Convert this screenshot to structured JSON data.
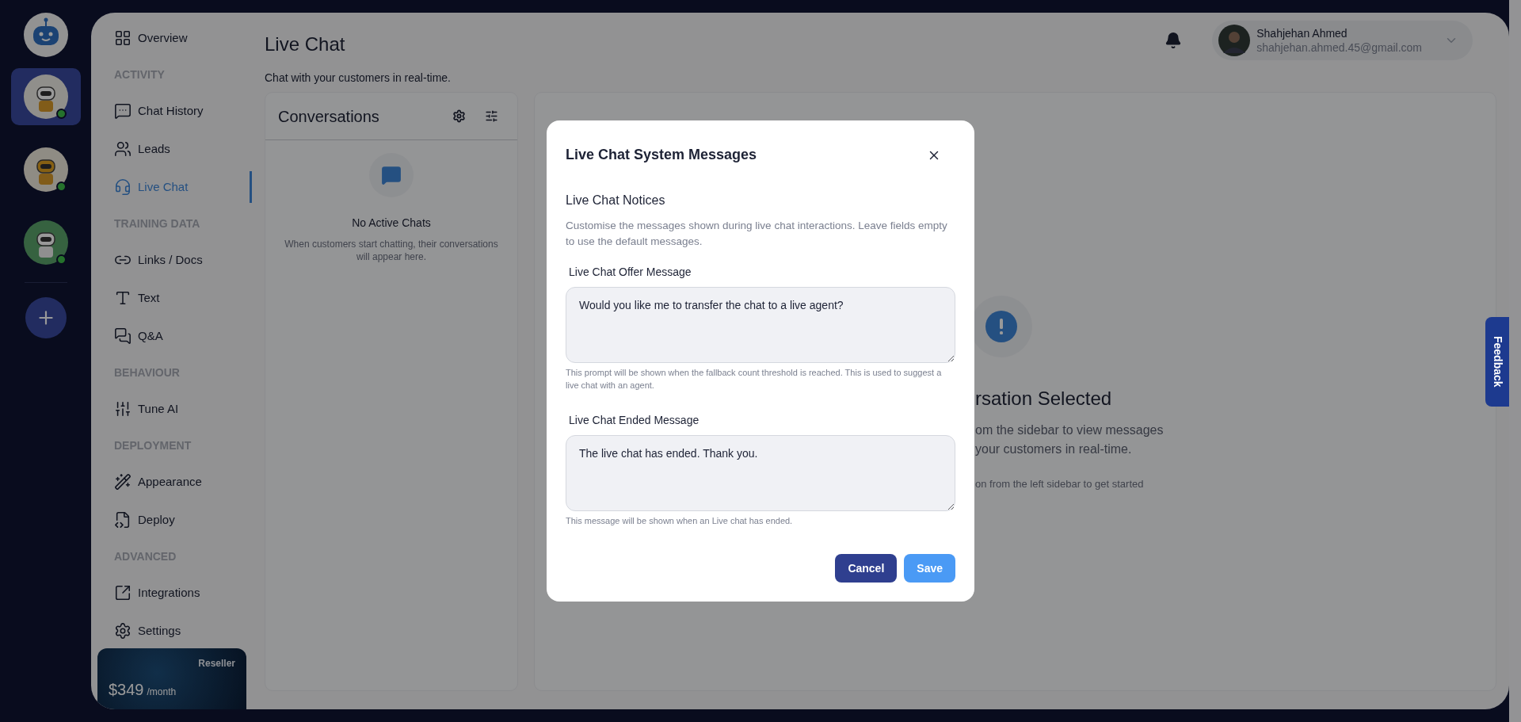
{
  "rail": {
    "bots": [
      {
        "selected": true,
        "online": true
      },
      {
        "selected": false,
        "online": true
      },
      {
        "selected": false,
        "online": true
      }
    ]
  },
  "sidebar": {
    "items": [
      {
        "kind": "item",
        "label": "Overview",
        "selected": false
      },
      {
        "kind": "header",
        "label": "ACTIVITY"
      },
      {
        "kind": "item",
        "label": "Chat History",
        "selected": false
      },
      {
        "kind": "item",
        "label": "Leads",
        "selected": false
      },
      {
        "kind": "item",
        "label": "Live Chat",
        "selected": true
      },
      {
        "kind": "header",
        "label": "TRAINING DATA"
      },
      {
        "kind": "item",
        "label": "Links / Docs",
        "selected": false
      },
      {
        "kind": "item",
        "label": "Text",
        "selected": false
      },
      {
        "kind": "item",
        "label": "Q&A",
        "selected": false
      },
      {
        "kind": "header",
        "label": "BEHAVIOUR"
      },
      {
        "kind": "item",
        "label": "Tune AI",
        "selected": false
      },
      {
        "kind": "header",
        "label": "DEPLOYMENT"
      },
      {
        "kind": "item",
        "label": "Appearance",
        "selected": false
      },
      {
        "kind": "item",
        "label": "Deploy",
        "selected": false
      },
      {
        "kind": "header",
        "label": "ADVANCED"
      },
      {
        "kind": "item",
        "label": "Integrations",
        "selected": false
      },
      {
        "kind": "item",
        "label": "Settings",
        "selected": false
      }
    ],
    "plan": {
      "badge": "Reseller",
      "price": "$349",
      "period": "/month"
    }
  },
  "header": {
    "title": "Live Chat",
    "subtitle": "Chat with your customers in real-time.",
    "user": {
      "name": "Shahjehan Ahmed",
      "email": "shahjehan.ahmed.45@gmail.com"
    }
  },
  "conversations": {
    "title": "Conversations",
    "empty_title": "No Active Chats",
    "empty_text": "When customers start chatting, their conversations will appear here."
  },
  "detail": {
    "title": "rsation Selected",
    "lines": [
      "om the sidebar to view messages",
      "your customers in real-time."
    ],
    "hint": "on from the left sidebar to get started"
  },
  "modal": {
    "title": "Live Chat System Messages",
    "section_title": "Live Chat Notices",
    "description": "Customise the messages shown during live chat interactions. Leave fields empty to use the default messages.",
    "fields": [
      {
        "label": "Live Chat Offer Message",
        "value": "Would you like me to transfer the chat to a live agent?",
        "help": "This prompt will be shown when the fallback count threshold is reached. This is used to suggest a live chat with an agent."
      },
      {
        "label": "Live Chat Ended Message",
        "value": "The live chat has ended. Thank you.",
        "help": "This message will be shown when an Live chat has ended."
      }
    ],
    "buttons": [
      {
        "kind": "secondary",
        "label": "Cancel"
      },
      {
        "kind": "primary",
        "label": "Save"
      }
    ]
  },
  "feedback": {
    "label": "Feedback"
  }
}
